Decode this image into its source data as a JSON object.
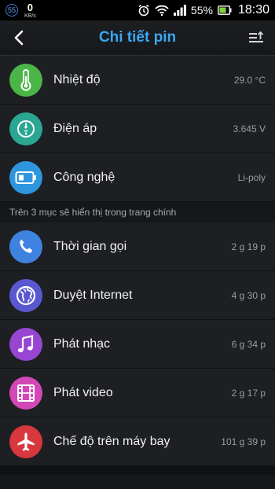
{
  "status_bar": {
    "notification_count": "55",
    "net_speed": "0",
    "net_unit": "KB/s",
    "battery_percent": "55%",
    "time": "18:30"
  },
  "header": {
    "title": "Chi tiết pin"
  },
  "info_items": [
    {
      "label": "Nhiệt độ",
      "value": "29.0 °C",
      "icon": "thermometer-icon",
      "color": "#4cb548"
    },
    {
      "label": "Điện áp",
      "value": "3.645 V",
      "icon": "voltage-icon",
      "color": "#2ba693"
    },
    {
      "label": "Công nghệ",
      "value": "Li-poly",
      "icon": "battery-icon",
      "color": "#2e96de"
    }
  ],
  "section_caption": "Trên 3 mục sẽ hiển thị trong trang chính",
  "usage_items": [
    {
      "label": "Thời gian gọi",
      "value": "2 g 19 p",
      "icon": "phone-icon",
      "color": "#3f83e0"
    },
    {
      "label": "Duyệt Internet",
      "value": "4 g 30 p",
      "icon": "globe-icon",
      "color": "#5a58cf"
    },
    {
      "label": "Phát nhạc",
      "value": "6 g 34 p",
      "icon": "music-note-icon",
      "color": "#9845d1"
    },
    {
      "label": "Phát video",
      "value": "2 g 17 p",
      "icon": "film-icon",
      "color": "#d248b6"
    },
    {
      "label": "Chế độ trên máy bay",
      "value": "101 g 39 p",
      "icon": "airplane-icon",
      "color": "#d7373d"
    }
  ]
}
